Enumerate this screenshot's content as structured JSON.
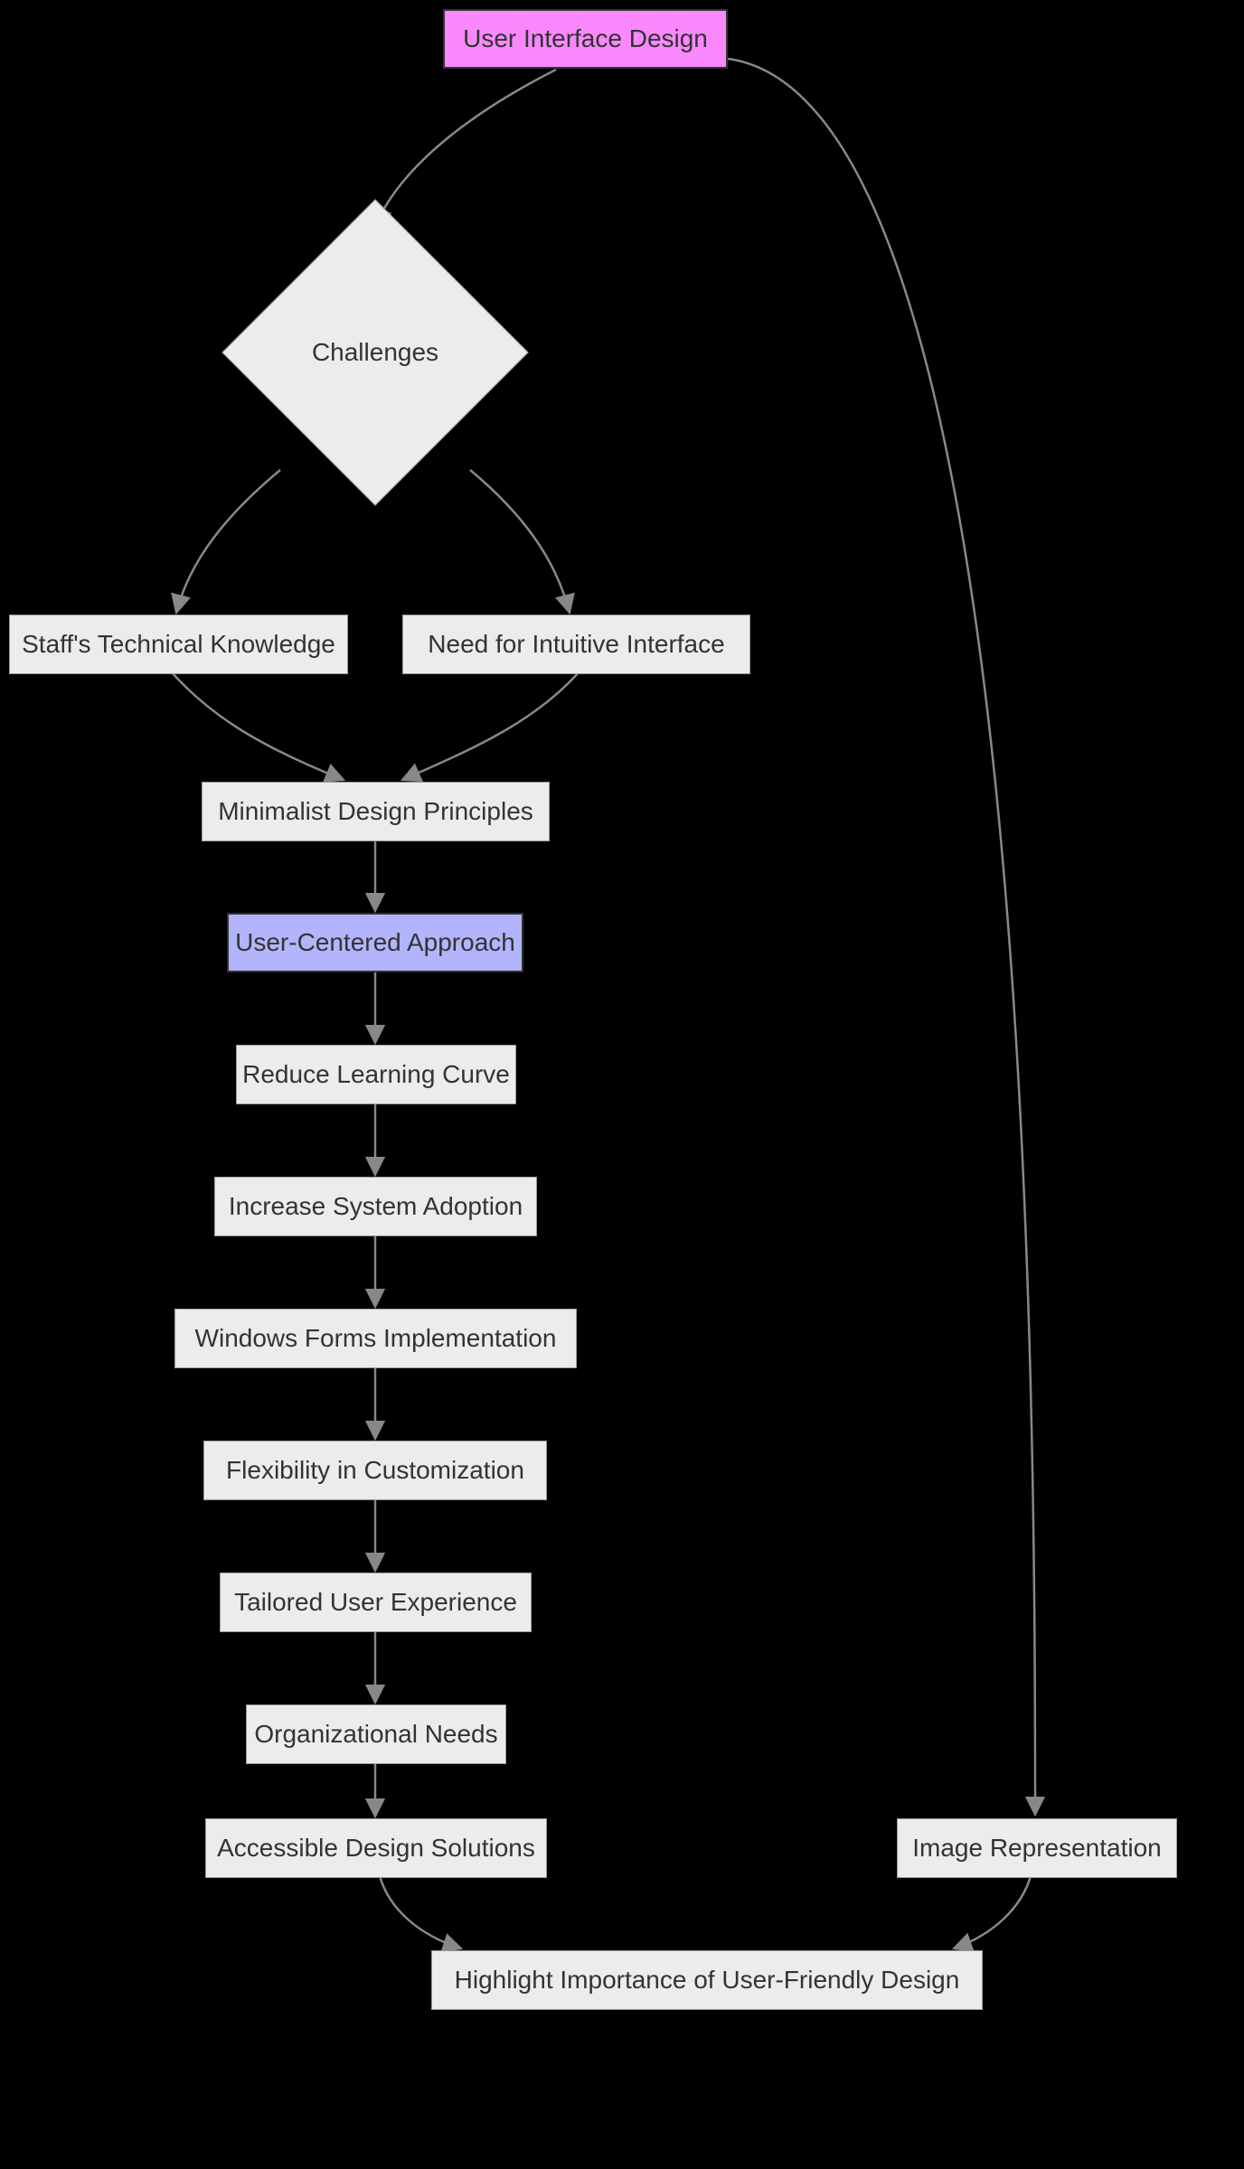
{
  "diagram": {
    "type": "flowchart",
    "direction": "top-down",
    "nodes": {
      "start": {
        "label": "User Interface Design",
        "shape": "rect",
        "style": "start"
      },
      "challenges": {
        "label": "Challenges",
        "shape": "diamond",
        "style": "default"
      },
      "tech_knowledge": {
        "label": "Staff's Technical Knowledge",
        "shape": "rect",
        "style": "default"
      },
      "intuitive": {
        "label": "Need for Intuitive Interface",
        "shape": "rect",
        "style": "default"
      },
      "minimalist": {
        "label": "Minimalist Design Principles",
        "shape": "rect",
        "style": "default"
      },
      "user_centered": {
        "label": "User-Centered Approach",
        "shape": "rect",
        "style": "highlight"
      },
      "reduce_curve": {
        "label": "Reduce Learning Curve",
        "shape": "rect",
        "style": "default"
      },
      "adoption": {
        "label": "Increase System Adoption",
        "shape": "rect",
        "style": "default"
      },
      "winforms": {
        "label": "Windows Forms Implementation",
        "shape": "rect",
        "style": "default"
      },
      "flexibility": {
        "label": "Flexibility in Customization",
        "shape": "rect",
        "style": "default"
      },
      "tailored": {
        "label": "Tailored User Experience",
        "shape": "rect",
        "style": "default"
      },
      "org_needs": {
        "label": "Organizational Needs",
        "shape": "rect",
        "style": "default"
      },
      "accessible": {
        "label": "Accessible Design Solutions",
        "shape": "rect",
        "style": "default"
      },
      "image_rep": {
        "label": "Image Representation",
        "shape": "rect",
        "style": "default"
      },
      "importance": {
        "label": "Highlight Importance of User-Friendly Design",
        "shape": "rect",
        "style": "default"
      }
    },
    "edges": [
      {
        "from": "start",
        "to": "challenges"
      },
      {
        "from": "start",
        "to": "image_rep"
      },
      {
        "from": "challenges",
        "to": "tech_knowledge"
      },
      {
        "from": "challenges",
        "to": "intuitive"
      },
      {
        "from": "tech_knowledge",
        "to": "minimalist"
      },
      {
        "from": "intuitive",
        "to": "minimalist"
      },
      {
        "from": "minimalist",
        "to": "user_centered"
      },
      {
        "from": "user_centered",
        "to": "reduce_curve"
      },
      {
        "from": "reduce_curve",
        "to": "adoption"
      },
      {
        "from": "adoption",
        "to": "winforms"
      },
      {
        "from": "winforms",
        "to": "flexibility"
      },
      {
        "from": "flexibility",
        "to": "tailored"
      },
      {
        "from": "tailored",
        "to": "org_needs"
      },
      {
        "from": "org_needs",
        "to": "accessible"
      },
      {
        "from": "accessible",
        "to": "importance"
      },
      {
        "from": "image_rep",
        "to": "importance"
      }
    ]
  }
}
